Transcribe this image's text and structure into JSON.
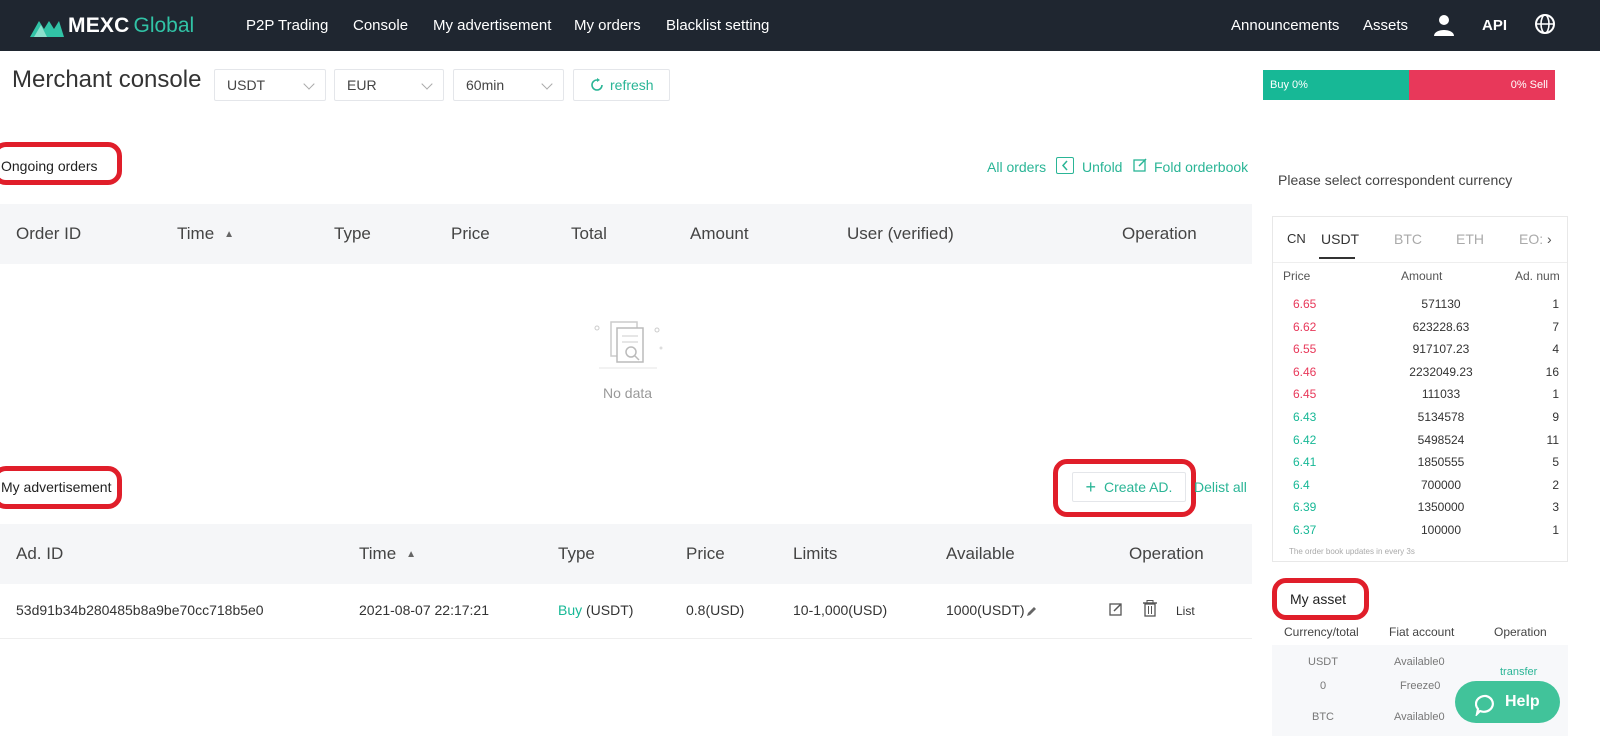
{
  "nav": {
    "logo_a": "MEXC",
    "logo_b": "Global",
    "items": [
      "P2P Trading",
      "Console",
      "My advertisement",
      "My orders",
      "Blacklist setting"
    ],
    "right": {
      "announcements": "Announcements",
      "assets": "Assets",
      "api": "API"
    }
  },
  "page": {
    "title": "Merchant console",
    "filters": {
      "coin": "USDT",
      "fiat": "EUR",
      "period": "60min"
    },
    "refresh": "refresh",
    "buy_bar": "Buy 0%",
    "sell_bar": "0% Sell"
  },
  "ongoing": {
    "label": "Ongoing orders",
    "all_orders": "All orders",
    "unfold": "Unfold",
    "fold": "Fold orderbook",
    "columns": [
      "Order ID",
      "Time",
      "Type",
      "Price",
      "Total",
      "Amount",
      "User (verified)",
      "Operation"
    ],
    "empty": "No data"
  },
  "ads": {
    "label": "My advertisement",
    "create": "Create AD.",
    "delist": "Delist all",
    "columns": [
      "Ad. ID",
      "Time",
      "Type",
      "Price",
      "Limits",
      "Available",
      "Operation"
    ],
    "row": {
      "id": "53d91b34b280485b8a9be70cc718b5e0",
      "time": "2021-08-07 22:17:21",
      "type_side": "Buy",
      "type_coin": "(USDT)",
      "price": "0.8(USD)",
      "limits": "10-1,000(USD)",
      "available": "1000(USDT)",
      "list": "List"
    }
  },
  "orderbook": {
    "prompt": "Please select correspondent currency",
    "tabs": [
      "CN",
      "USDT",
      "BTC",
      "ETH",
      "EO:"
    ],
    "headers": [
      "Price",
      "Amount",
      "Ad. num"
    ],
    "rows": [
      {
        "price": "6.65",
        "amount": "571130",
        "num": "1",
        "side": "sell"
      },
      {
        "price": "6.62",
        "amount": "623228.63",
        "num": "7",
        "side": "sell"
      },
      {
        "price": "6.55",
        "amount": "917107.23",
        "num": "4",
        "side": "sell"
      },
      {
        "price": "6.46",
        "amount": "2232049.23",
        "num": "16",
        "side": "sell"
      },
      {
        "price": "6.45",
        "amount": "111033",
        "num": "1",
        "side": "sell"
      },
      {
        "price": "6.43",
        "amount": "5134578",
        "num": "9",
        "side": "buy"
      },
      {
        "price": "6.42",
        "amount": "5498524",
        "num": "11",
        "side": "buy"
      },
      {
        "price": "6.41",
        "amount": "1850555",
        "num": "5",
        "side": "buy"
      },
      {
        "price": "6.4",
        "amount": "700000",
        "num": "2",
        "side": "buy"
      },
      {
        "price": "6.39",
        "amount": "1350000",
        "num": "3",
        "side": "buy"
      },
      {
        "price": "6.37",
        "amount": "100000",
        "num": "1",
        "side": "buy"
      }
    ],
    "note": "The order book updates in every 3s"
  },
  "asset": {
    "label": "My asset",
    "headers": [
      "Currency/total",
      "Fiat account",
      "Operation"
    ],
    "usdt": "USDT",
    "usdt_total": "0",
    "available": "Available0",
    "freeze": "Freeze0",
    "transfer": "transfer",
    "btc": "BTC",
    "btc_available": "Available0"
  },
  "help": "Help",
  "colors": {
    "accent": "#2ab596",
    "sell": "#e8385a",
    "buy": "#17b896",
    "nav_bg": "#1f2630",
    "highlight": "#e01e2a"
  }
}
